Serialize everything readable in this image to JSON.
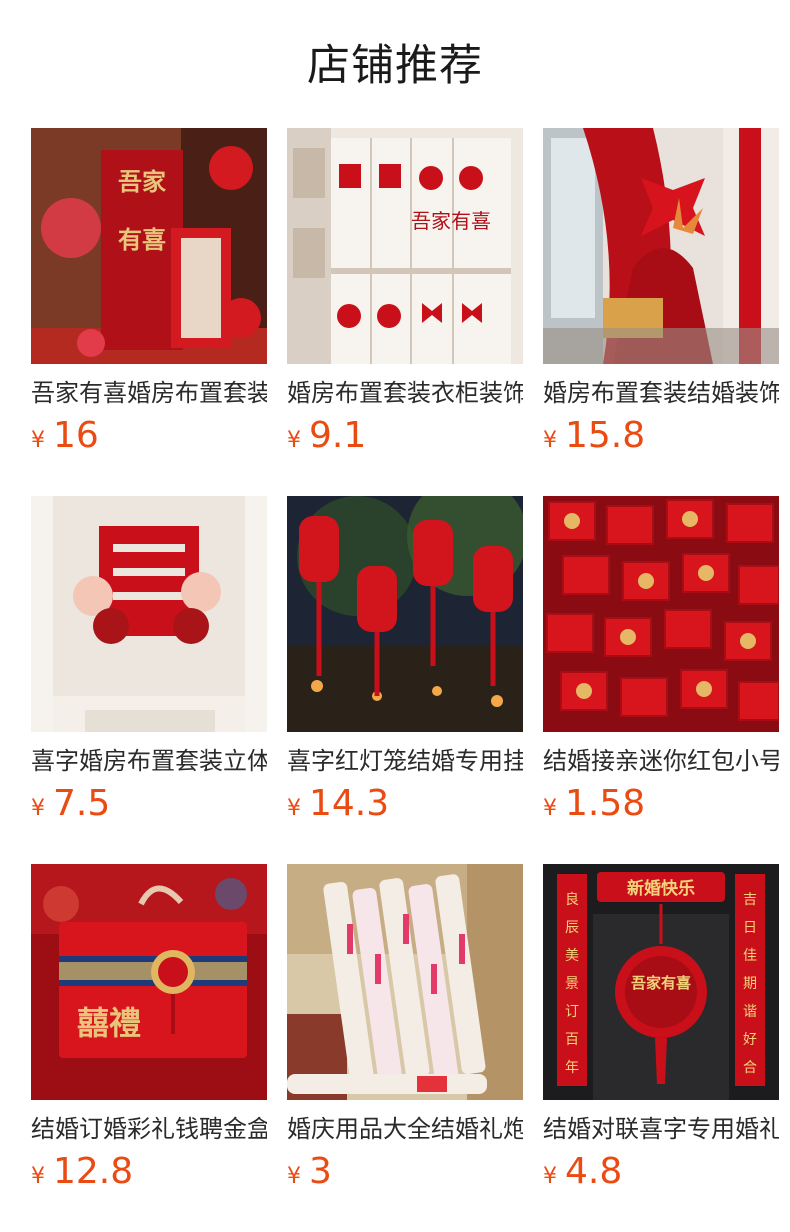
{
  "page": {
    "title": "店铺推荐"
  },
  "currency": "¥",
  "colors": {
    "price": "#ea4b13",
    "title": "#2b2b2b",
    "brand_red": "#c9101a"
  },
  "products": [
    {
      "title": "吾家有喜婚房布置套装",
      "price": "16",
      "image": "wedding-room-backdrop-image",
      "image_text": [
        "吾家",
        "有喜"
      ]
    },
    {
      "title": "婚房布置套装衣柜装饰",
      "price": "9.1",
      "image": "wardrobe-stickers-image",
      "image_text": [
        "吾家",
        "有喜"
      ]
    },
    {
      "title": "婚房布置套装结婚装饰",
      "price": "15.8",
      "image": "red-bow-drape-image",
      "image_text": []
    },
    {
      "title": "喜字婚房布置套装立体",
      "price": "7.5",
      "image": "double-happiness-wall-image",
      "image_text": []
    },
    {
      "title": "喜字红灯笼结婚专用挂件",
      "price": "14.3",
      "image": "red-lanterns-image",
      "image_text": []
    },
    {
      "title": "结婚接亲迷你红包小号",
      "price": "1.58",
      "image": "red-envelopes-image",
      "image_text": []
    },
    {
      "title": "结婚订婚彩礼钱聘金盒",
      "price": "12.8",
      "image": "gift-box-image",
      "image_text": [
        "囍禮"
      ]
    },
    {
      "title": "婚庆用品大全结婚礼炮",
      "price": "3",
      "image": "confetti-tubes-image",
      "image_text": []
    },
    {
      "title": "结婚对联喜字专用婚礼",
      "price": "4.8",
      "image": "couplet-door-image",
      "image_text": [
        "新婚快乐",
        "良辰美景订百年",
        "吉日佳期谐好合",
        "吾家有喜"
      ]
    }
  ]
}
